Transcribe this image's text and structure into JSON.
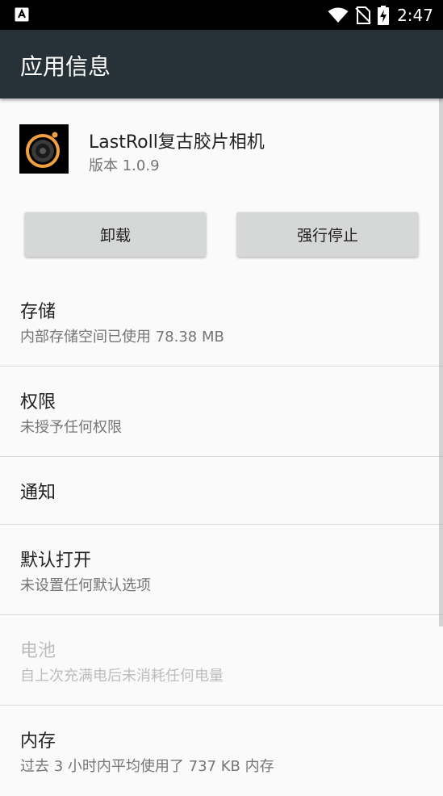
{
  "status_bar": {
    "time": "2:47",
    "icons": [
      "notification-app-icon",
      "wifi-icon",
      "no-sim-icon",
      "battery-charging-icon"
    ]
  },
  "app_bar": {
    "title": "应用信息"
  },
  "app": {
    "name": "LastRoll复古胶片相机",
    "version": "版本 1.0.9"
  },
  "buttons": {
    "uninstall": "卸载",
    "force_stop": "强行停止"
  },
  "items": [
    {
      "title": "存储",
      "summary": "内部存储空间已使用 78.38 MB",
      "enabled": true
    },
    {
      "title": "权限",
      "summary": "未授予任何权限",
      "enabled": true
    },
    {
      "title": "通知",
      "summary": "",
      "enabled": true
    },
    {
      "title": "默认打开",
      "summary": "未设置任何默认选项",
      "enabled": true
    },
    {
      "title": "电池",
      "summary": "自上次充满电后未消耗任何电量",
      "enabled": false
    },
    {
      "title": "内存",
      "summary": "过去 3 小时内平均使用了 737 KB 内存",
      "enabled": true
    }
  ],
  "colors": {
    "status_bar": "#000000",
    "app_bar": "#263238",
    "background": "#fafafa",
    "button": "#d6d7d7",
    "primary_text": "#212121",
    "secondary_text": "#757575",
    "disabled_text": "#bdbdbd"
  }
}
